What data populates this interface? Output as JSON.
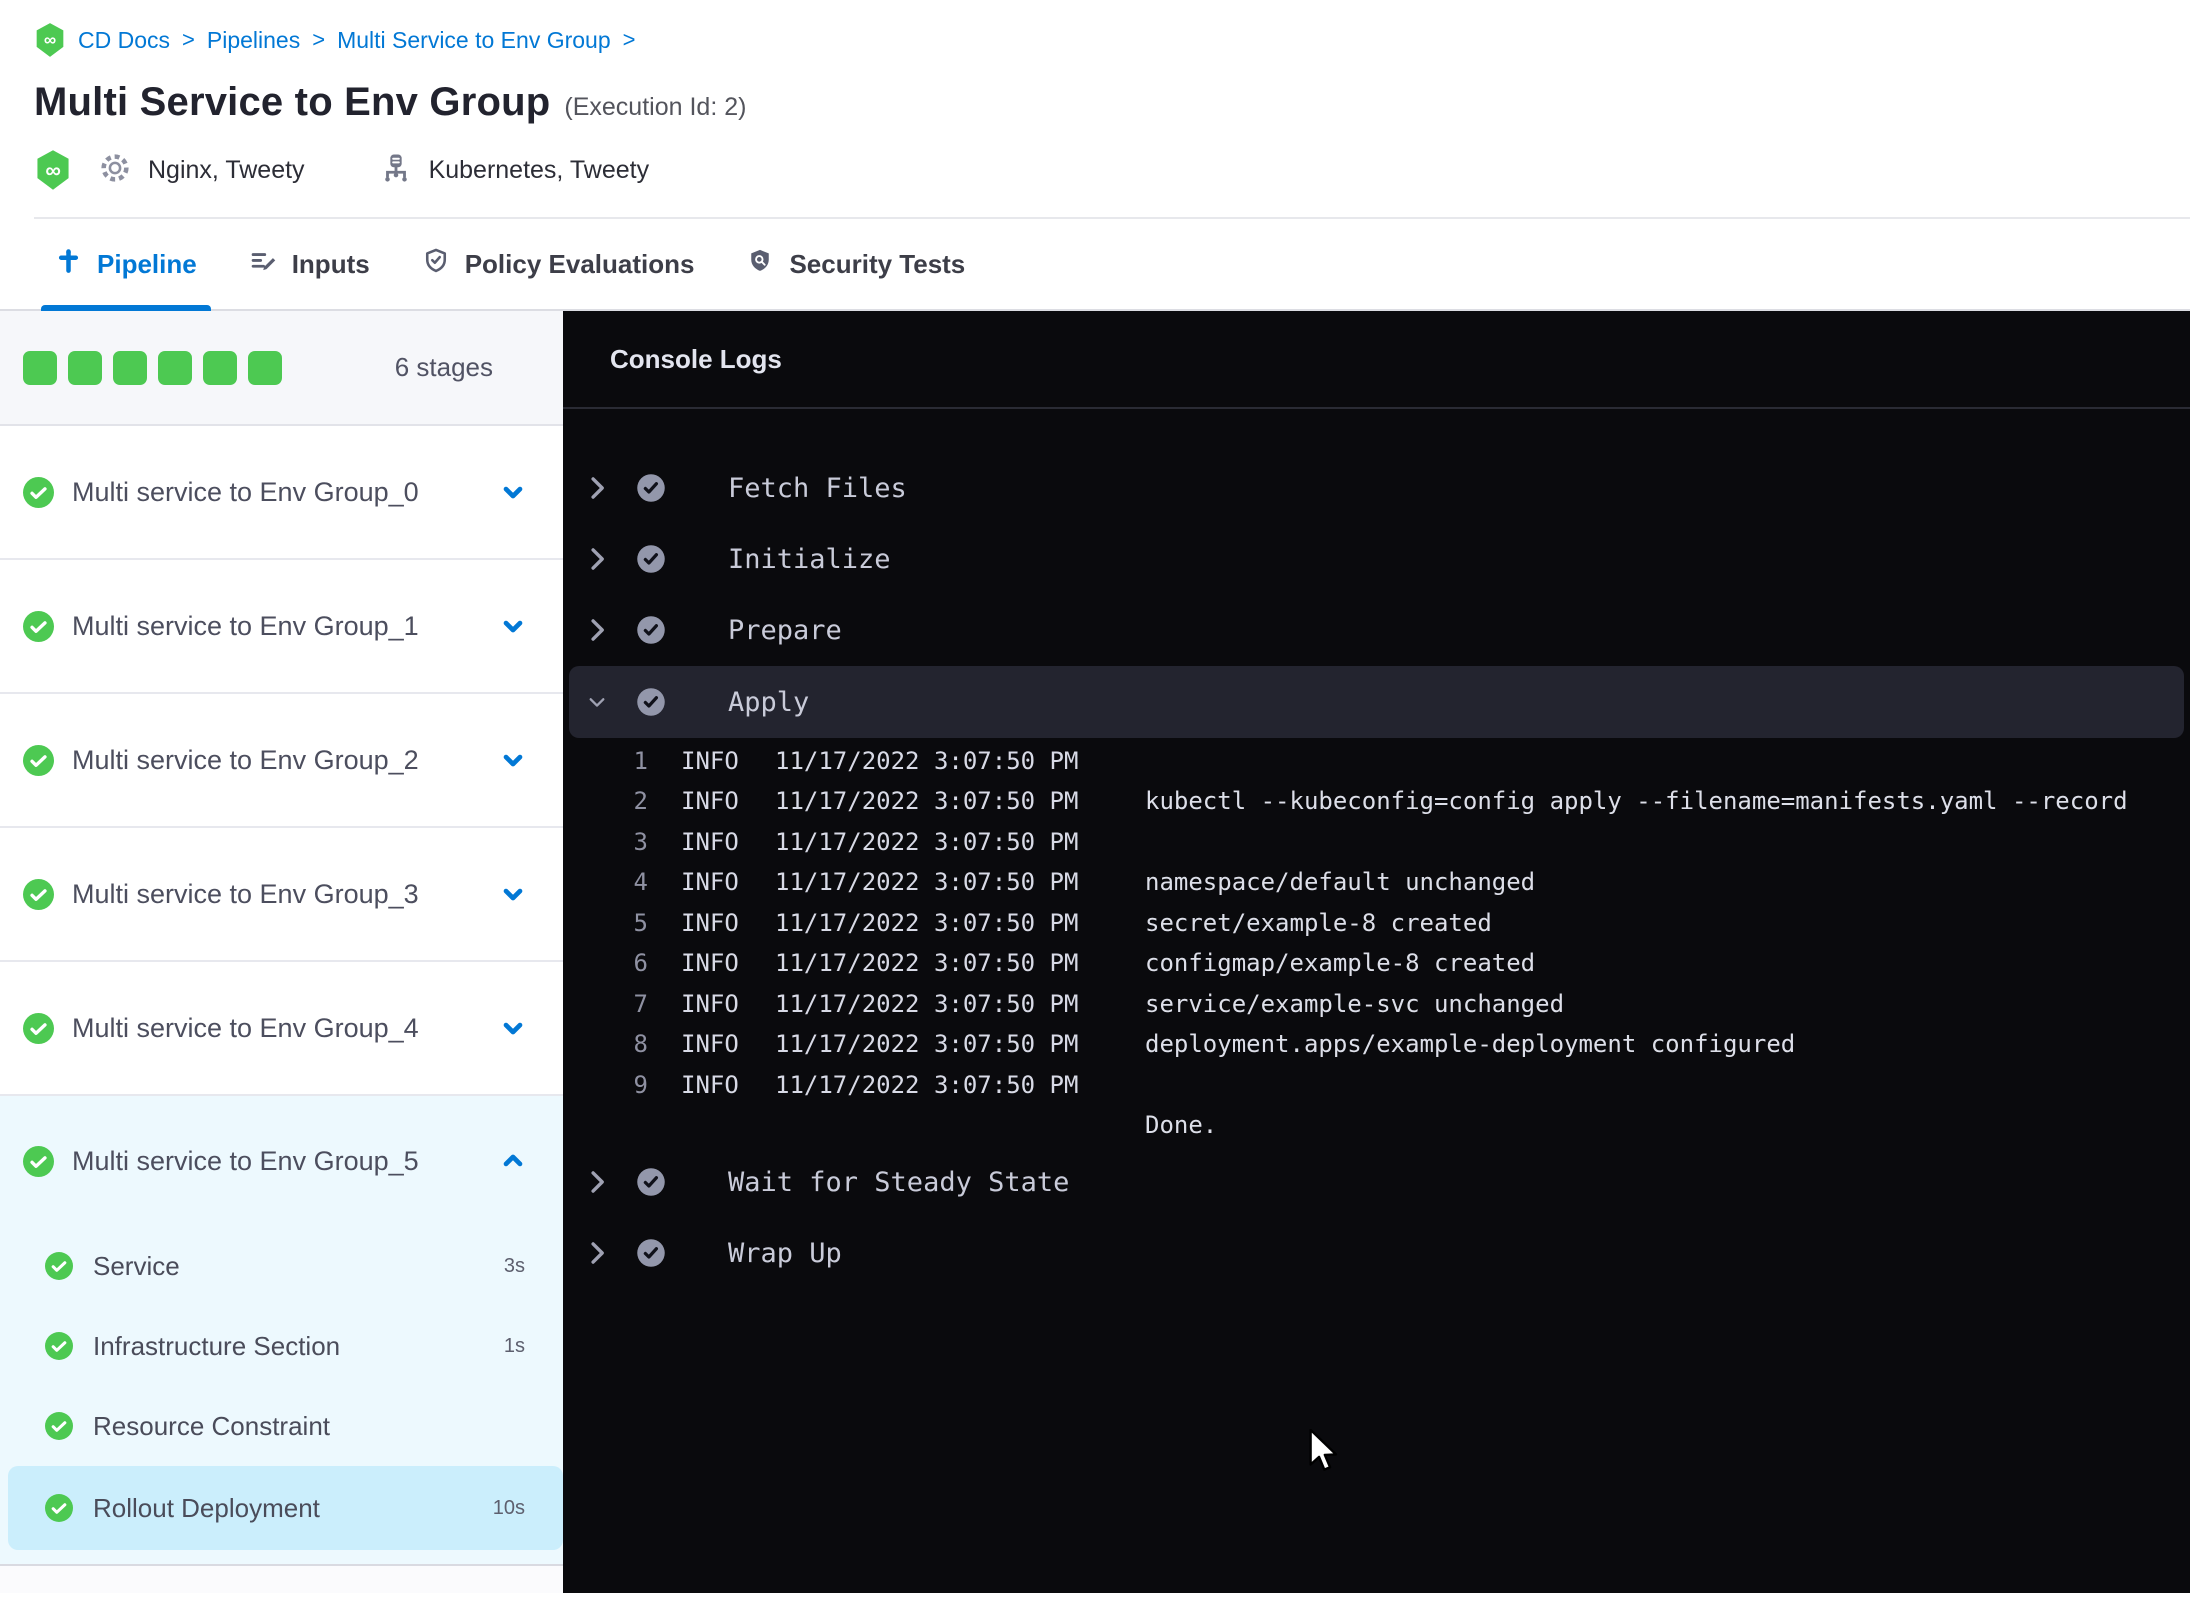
{
  "colors": {
    "accent_blue": "#0278d5",
    "success_green": "#4dc952"
  },
  "breadcrumb": {
    "separator": ">",
    "items": [
      "CD Docs",
      "Pipelines",
      "Multi Service to Env Group"
    ]
  },
  "header": {
    "title": "Multi Service to Env Group",
    "execution_id": "(Execution Id: 2)",
    "services_label": "Nginx, Tweety",
    "infrastructure_label": "Kubernetes, Tweety"
  },
  "tabs": [
    {
      "label": "Pipeline",
      "active": true
    },
    {
      "label": "Inputs",
      "active": false
    },
    {
      "label": "Policy Evaluations",
      "active": false
    },
    {
      "label": "Security Tests",
      "active": false
    }
  ],
  "stages_panel": {
    "stage_count_label": "6 stages",
    "stages": [
      {
        "label": "Multi service to Env Group_0",
        "status": "success"
      },
      {
        "label": "Multi service to Env Group_1",
        "status": "success"
      },
      {
        "label": "Multi service to Env Group_2",
        "status": "success"
      },
      {
        "label": "Multi service to Env Group_3",
        "status": "success"
      },
      {
        "label": "Multi service to Env Group_4",
        "status": "success"
      },
      {
        "label": "Multi service to Env Group_5",
        "status": "success",
        "expanded": true,
        "steps": [
          {
            "label": "Service",
            "duration": "3s",
            "status": "success"
          },
          {
            "label": "Infrastructure Section",
            "duration": "1s",
            "status": "success"
          },
          {
            "label": "Resource Constraint",
            "duration": "",
            "status": "success"
          },
          {
            "label": "Rollout Deployment",
            "duration": "10s",
            "status": "success",
            "selected": true
          }
        ]
      }
    ]
  },
  "console": {
    "title": "Console Logs",
    "steps": [
      {
        "label": "Fetch Files",
        "status": "success"
      },
      {
        "label": "Initialize",
        "status": "success"
      },
      {
        "label": "Prepare",
        "status": "success"
      },
      {
        "label": "Apply",
        "status": "success",
        "expanded": true
      },
      {
        "label": "Wait for Steady State",
        "status": "success"
      },
      {
        "label": "Wrap Up",
        "status": "success"
      }
    ],
    "done_text": "Done.",
    "logs": [
      {
        "num": "1",
        "level": "INFO",
        "timestamp": "11/17/2022 3:07:50 PM",
        "message": ""
      },
      {
        "num": "2",
        "level": "INFO",
        "timestamp": "11/17/2022 3:07:50 PM",
        "message": "kubectl --kubeconfig=config apply --filename=manifests.yaml --record"
      },
      {
        "num": "3",
        "level": "INFO",
        "timestamp": "11/17/2022 3:07:50 PM",
        "message": ""
      },
      {
        "num": "4",
        "level": "INFO",
        "timestamp": "11/17/2022 3:07:50 PM",
        "message": "namespace/default unchanged"
      },
      {
        "num": "5",
        "level": "INFO",
        "timestamp": "11/17/2022 3:07:50 PM",
        "message": "secret/example-8 created"
      },
      {
        "num": "6",
        "level": "INFO",
        "timestamp": "11/17/2022 3:07:50 PM",
        "message": "configmap/example-8 created"
      },
      {
        "num": "7",
        "level": "INFO",
        "timestamp": "11/17/2022 3:07:50 PM",
        "message": "service/example-svc unchanged"
      },
      {
        "num": "8",
        "level": "INFO",
        "timestamp": "11/17/2022 3:07:50 PM",
        "message": "deployment.apps/example-deployment configured"
      },
      {
        "num": "9",
        "level": "INFO",
        "timestamp": "11/17/2022 3:07:50 PM",
        "message": ""
      }
    ]
  }
}
